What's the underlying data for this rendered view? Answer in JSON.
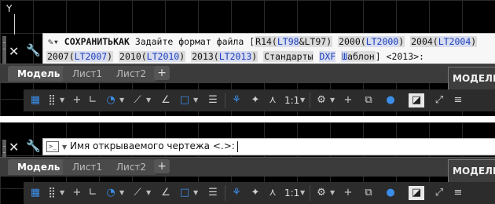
{
  "top": {
    "ucs_label": "Y",
    "command_icon": "command-history-icon",
    "cmd_name": "СОХРАНИТЬКАК",
    "line1": {
      "prompt": "Задайте формат файла [",
      "opt1_pre": "R14(",
      "opt1_kw1": "LT98",
      "opt1_mid": "&LT97",
      "opt1_end": ")",
      "opt2_pre": "2000(",
      "opt2_kw": "LT2000",
      "opt2_end": ")",
      "opt3_pre": "2004(",
      "opt3_kw": "LT2004",
      "opt3_end": ")"
    },
    "line2": {
      "opt4_pre": "2007(",
      "opt4_kw": "LT2007",
      "opt4_end": ")",
      "opt5_pre": "2010(",
      "opt5_kw": "LT2010",
      "opt5_end": ")",
      "opt6_pre": "2013(",
      "opt6_kw": "LT2013",
      "opt6_end": ")",
      "opt7": "Стандарты",
      "opt8_kw": "DXF",
      "opt9_kw": "Ш",
      "opt9_rest": "аблон",
      "tail": "] <2013>:"
    }
  },
  "bottom": {
    "prompt_text": "Имя открываемого чертежа <.>:"
  },
  "tabs": {
    "model": "Модель",
    "sheet1": "Лист1",
    "sheet2": "Лист2",
    "add": "+"
  },
  "model_button": "МОДЕЛЬ",
  "status": {
    "scale": "1:1",
    "icons": [
      "grid-icon",
      "snap-icon",
      "infer-icon",
      "ortho-icon",
      "polar-icon",
      "isodraft-icon",
      "osnap-icon",
      "track-icon",
      "lineweight-icon",
      "transparency-icon",
      "selection-cycling-icon",
      "annotation-visibility-icon",
      "autoscale-icon",
      "annotation-scale-icon",
      "workspace-gear-icon",
      "annomonitor-icon",
      "units-icon",
      "isolate-icon",
      "hardware-accel-icon",
      "clean-screen-icon",
      "customize-icon"
    ]
  },
  "colors": {
    "accent": "#3b8ee8",
    "command_bg": "#f7f7f7",
    "canvas_bg": "#000000",
    "status_bg": "#2c2c2c"
  }
}
